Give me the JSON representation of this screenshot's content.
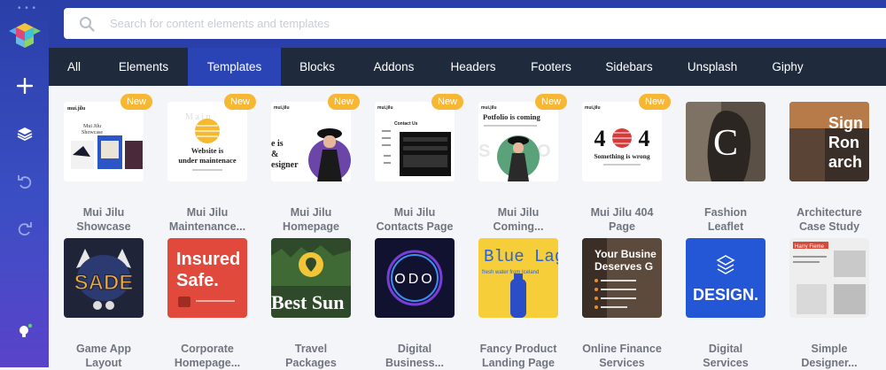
{
  "sidebar": {
    "handle": "• • •",
    "buttons": [
      {
        "name": "logo-icon"
      },
      {
        "name": "add-icon"
      },
      {
        "name": "layers-icon"
      },
      {
        "name": "undo-icon"
      },
      {
        "name": "redo-icon"
      },
      {
        "name": "lightbulb-icon"
      }
    ]
  },
  "search": {
    "placeholder": "Search for content elements and templates"
  },
  "tabs": [
    {
      "label": "All",
      "active": false
    },
    {
      "label": "Elements",
      "active": false
    },
    {
      "label": "Templates",
      "active": true
    },
    {
      "label": "Blocks",
      "active": false
    },
    {
      "label": "Addons",
      "active": false
    },
    {
      "label": "Headers",
      "active": false
    },
    {
      "label": "Footers",
      "active": false
    },
    {
      "label": "Sidebars",
      "active": false
    },
    {
      "label": "Unsplash",
      "active": false
    },
    {
      "label": "Giphy",
      "active": false
    }
  ],
  "badge_label": "New",
  "colors": {
    "accent": "#2a43b5",
    "tabbar": "#1f2a3d",
    "badge": "#f7b733",
    "title": "#6f7580"
  },
  "row1": [
    {
      "line1": "Mui Jilu",
      "line2": "Showcase",
      "badge": true,
      "thumb_text": "Mui Jilu Showcase"
    },
    {
      "line1": "Mui Jilu",
      "line2": "Maintenance...",
      "badge": true,
      "thumb_text": "Website is under maintenace"
    },
    {
      "line1": "Mui Jilu",
      "line2": "Homepage",
      "badge": true,
      "thumb_text": "e is & esigner"
    },
    {
      "line1": "Mui Jilu",
      "line2": "Contacts Page",
      "badge": true,
      "thumb_text": "Contact Us"
    },
    {
      "line1": "Mui Jilu",
      "line2": "Coming...",
      "badge": true,
      "thumb_text": "Potfolio is coming"
    },
    {
      "line1": "Mui Jilu 404",
      "line2": "Page",
      "badge": true,
      "thumb_text": "4 4",
      "thumb_sub": "Something is wrong"
    },
    {
      "line1": "Fashion",
      "line2": "Leaflet",
      "badge": false,
      "thumb_text": "C"
    },
    {
      "line1": "Architecture",
      "line2": "Case Study",
      "badge": false,
      "thumb_text": "Sign Ron arch"
    }
  ],
  "row2": [
    {
      "line1": "Game App",
      "line2": "Layout",
      "thumb_text": "SADE"
    },
    {
      "line1": "Corporate",
      "line2": "Homepage...",
      "thumb_text": "Insured Safe."
    },
    {
      "line1": "Travel",
      "line2": "Packages",
      "thumb_text": "Best Sun"
    },
    {
      "line1": "Digital",
      "line2": "Business...",
      "thumb_text": "ODO"
    },
    {
      "line1": "Fancy Product",
      "line2": "Landing Page",
      "thumb_text": "Blue Lag",
      "thumb_sub": "fresh water from Iceland"
    },
    {
      "line1": "Online Finance",
      "line2": "Services",
      "thumb_text": "Your Busine Deserves G"
    },
    {
      "line1": "Digital",
      "line2": "Services",
      "thumb_text": "DESIGN."
    },
    {
      "line1": "Simple",
      "line2": "Designer...",
      "thumb_text": "Harry Fieme"
    }
  ]
}
